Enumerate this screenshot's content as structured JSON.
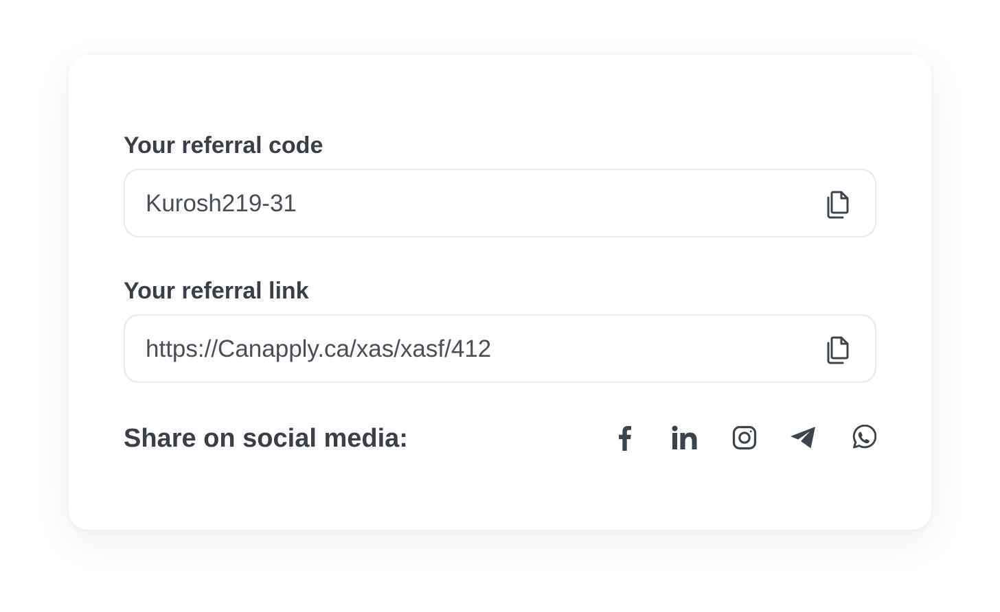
{
  "referral_code": {
    "label": "Your referral code",
    "value": "Kurosh219-31",
    "copy_icon": "copy-icon"
  },
  "referral_link": {
    "label": "Your referral link",
    "value": "https://Canapply.ca/xas/xasf/412",
    "copy_icon": "copy-icon"
  },
  "share": {
    "label": "Share on social media:",
    "networks": [
      "facebook-icon",
      "linkedin-icon",
      "instagram-icon",
      "telegram-icon",
      "whatsapp-icon"
    ]
  },
  "colors": {
    "text": "#3a3f47",
    "border": "#e6e8ec",
    "icon": "#3d434b"
  }
}
